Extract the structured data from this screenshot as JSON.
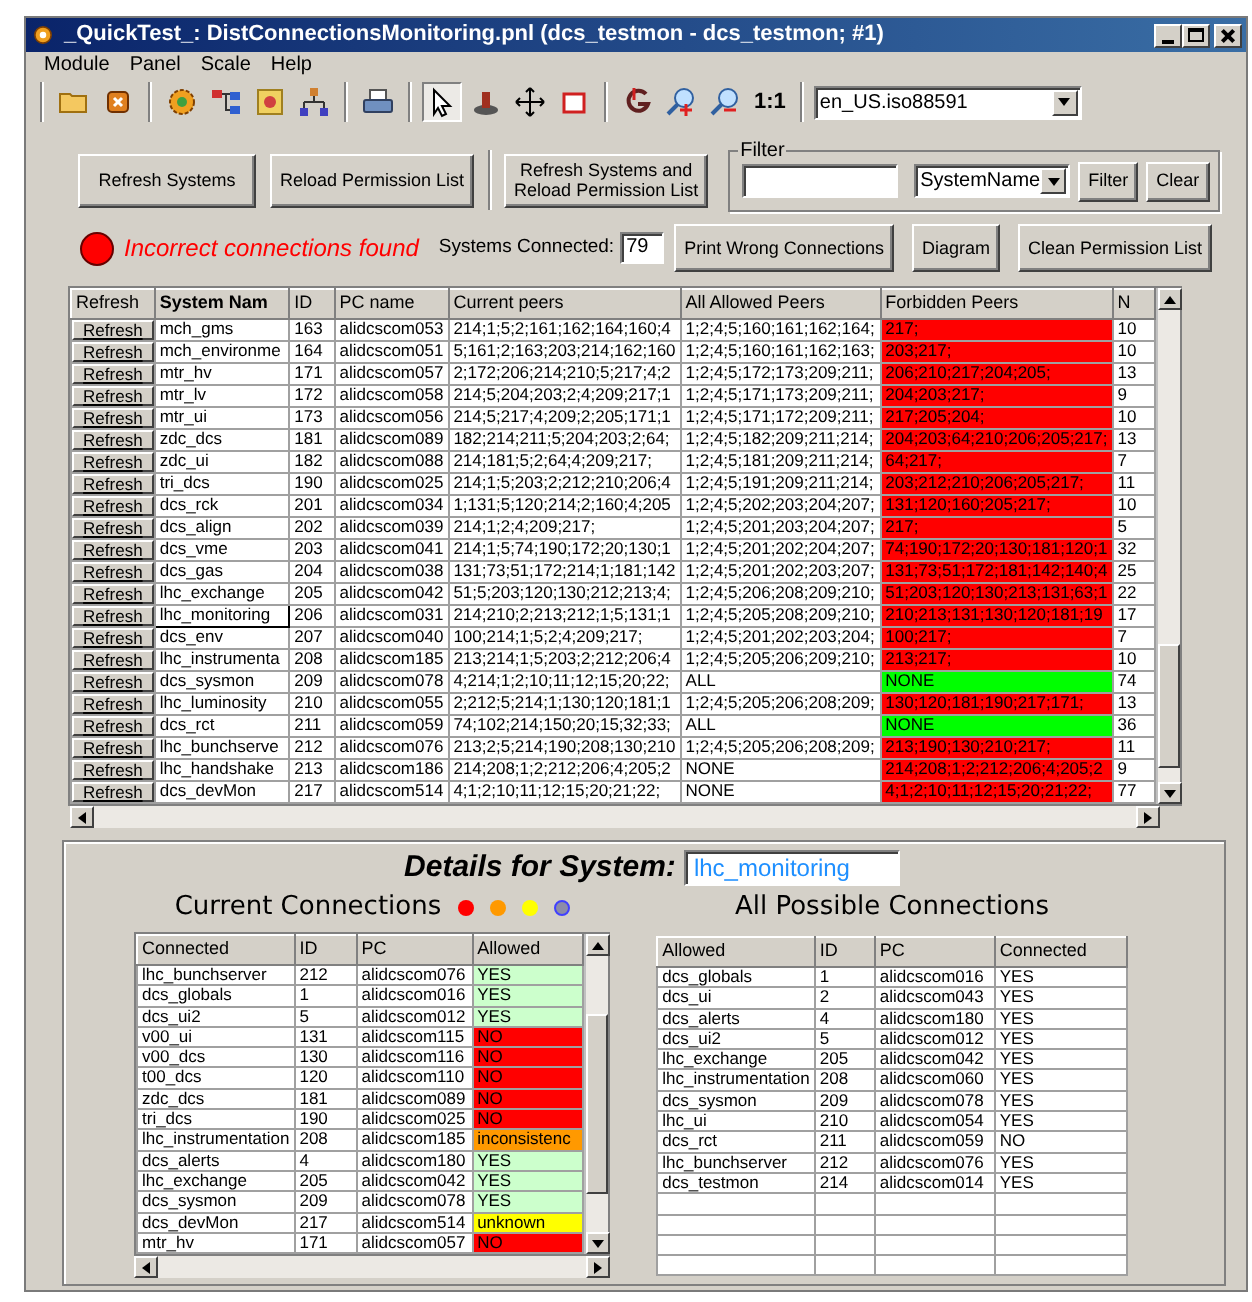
{
  "window": {
    "title": "_QuickTest_: DistConnectionsMonitoring.pnl (dcs_testmon - dcs_testmon; #1)"
  },
  "menu": [
    "Module",
    "Panel",
    "Scale",
    "Help"
  ],
  "toolbar": {
    "groups": [
      [
        {
          "kind": "folder",
          "selected": false
        },
        {
          "kind": "close",
          "selected": false
        }
      ],
      [
        {
          "kind": "gear",
          "selected": false
        },
        {
          "kind": "nodes",
          "selected": false
        },
        {
          "kind": "picture",
          "selected": false
        },
        {
          "kind": "hierarchy",
          "selected": false
        }
      ],
      [
        {
          "kind": "printer",
          "selected": false
        }
      ],
      [
        {
          "kind": "pointer",
          "selected": true
        },
        {
          "kind": "stamp",
          "selected": false
        },
        {
          "kind": "move",
          "selected": false
        },
        {
          "kind": "rectangle",
          "selected": false
        }
      ],
      [
        {
          "kind": "graph",
          "selected": false
        },
        {
          "kind": "zoom-in",
          "selected": false
        },
        {
          "kind": "zoom-out",
          "selected": false
        },
        {
          "kind": "text",
          "label": "1:1",
          "selected": false
        }
      ]
    ],
    "locale": "en_US.iso88591"
  },
  "actions": [
    "Refresh Systems",
    "Reload Permission List"
  ],
  "refresh_all": [
    "Refresh Systems and",
    "Reload Permission List"
  ],
  "filter": {
    "legend": "Filter",
    "field": "SystemName",
    "buttons": [
      "Filter",
      "Clear"
    ]
  },
  "alarm": {
    "active": true,
    "message": "Incorrect connections found"
  },
  "systems_connected": {
    "label": "Systems Connected:",
    "value": "79"
  },
  "tools": [
    "Print Wrong Connections",
    "Diagram",
    "Clean Permission List"
  ],
  "main_table": {
    "columns": [
      "Refresh",
      "System Nam",
      "ID",
      "PC name",
      "Current peers",
      "All Allowed Peers",
      "Forbidden Peers",
      "N"
    ],
    "rows": [
      {
        "button": "Refresh",
        "system": "mch_gms",
        "id": "163",
        "pc": "alidcscom053",
        "current": "214;1;5;2;161;162;164;160;4",
        "allowed": "1;2;4;5;160;161;162;164;",
        "forbidden": "217;",
        "violation": true,
        "n": "10",
        "selected": false
      },
      {
        "button": "Refresh",
        "system": "mch_environme",
        "id": "164",
        "pc": "alidcscom051",
        "current": "5;161;2;163;203;214;162;160",
        "allowed": "1;2;4;5;160;161;162;163;",
        "forbidden": "203;217;",
        "violation": true,
        "n": "10",
        "selected": false
      },
      {
        "button": "Refresh",
        "system": "mtr_hv",
        "id": "171",
        "pc": "alidcscom057",
        "current": "2;172;206;214;210;5;217;4;2",
        "allowed": "1;2;4;5;172;173;209;211;",
        "forbidden": "206;210;217;204;205;",
        "violation": true,
        "n": "13",
        "selected": false
      },
      {
        "button": "Refresh",
        "system": "mtr_lv",
        "id": "172",
        "pc": "alidcscom058",
        "current": "214;5;204;203;2;4;209;217;1",
        "allowed": "1;2;4;5;171;173;209;211;",
        "forbidden": "204;203;217;",
        "violation": true,
        "n": "9",
        "selected": false
      },
      {
        "button": "Refresh",
        "system": "mtr_ui",
        "id": "173",
        "pc": "alidcscom056",
        "current": "214;5;217;4;209;2;205;171;1",
        "allowed": "1;2;4;5;171;172;209;211;",
        "forbidden": "217;205;204;",
        "violation": true,
        "n": "10",
        "selected": false
      },
      {
        "button": "Refresh",
        "system": "zdc_dcs",
        "id": "181",
        "pc": "alidcscom089",
        "current": "182;214;211;5;204;203;2;64;",
        "allowed": "1;2;4;5;182;209;211;214;",
        "forbidden": "204;203;64;210;206;205;217;",
        "violation": true,
        "n": "13",
        "selected": false
      },
      {
        "button": "Refresh",
        "system": "zdc_ui",
        "id": "182",
        "pc": "alidcscom088",
        "current": "214;181;5;2;64;4;209;217;",
        "allowed": "1;2;4;5;181;209;211;214;",
        "forbidden": "64;217;",
        "violation": true,
        "n": "7",
        "selected": false
      },
      {
        "button": "Refresh",
        "system": "tri_dcs",
        "id": "190",
        "pc": "alidcscom025",
        "current": "214;1;5;203;2;212;210;206;4",
        "allowed": "1;2;4;5;191;209;211;214;",
        "forbidden": "203;212;210;206;205;217;",
        "violation": true,
        "n": "11",
        "selected": false
      },
      {
        "button": "Refresh",
        "system": "dcs_rck",
        "id": "201",
        "pc": "alidcscom034",
        "current": "1;131;5;120;214;2;160;4;205",
        "allowed": "1;2;4;5;202;203;204;207;",
        "forbidden": "131;120;160;205;217;",
        "violation": true,
        "n": "10",
        "selected": false
      },
      {
        "button": "Refresh",
        "system": "dcs_align",
        "id": "202",
        "pc": "alidcscom039",
        "current": "214;1;2;4;209;217;",
        "allowed": "1;2;4;5;201;203;204;207;",
        "forbidden": "217;",
        "violation": true,
        "n": "5",
        "selected": false
      },
      {
        "button": "Refresh",
        "system": "dcs_vme",
        "id": "203",
        "pc": "alidcscom041",
        "current": "214;1;5;74;190;172;20;130;1",
        "allowed": "1;2;4;5;201;202;204;207;",
        "forbidden": "74;190;172;20;130;181;120;1",
        "violation": true,
        "n": "32",
        "selected": false
      },
      {
        "button": "Refresh",
        "system": "dcs_gas",
        "id": "204",
        "pc": "alidcscom038",
        "current": "131;73;51;172;214;1;181;142",
        "allowed": "1;2;4;5;201;202;203;207;",
        "forbidden": "131;73;51;172;181;142;140;4",
        "violation": true,
        "n": "25",
        "selected": false
      },
      {
        "button": "Refresh",
        "system": "lhc_exchange",
        "id": "205",
        "pc": "alidcscom042",
        "current": "51;5;203;120;130;212;213;4;",
        "allowed": "1;2;4;5;206;208;209;210;",
        "forbidden": "51;203;120;130;213;131;63;1",
        "violation": true,
        "n": "22",
        "selected": false
      },
      {
        "button": "Refresh",
        "system": "lhc_monitoring",
        "id": "206",
        "pc": "alidcscom031",
        "current": "214;210;2;213;212;1;5;131;1",
        "allowed": "1;2;4;5;205;208;209;210;",
        "forbidden": "210;213;131;130;120;181;19",
        "violation": true,
        "n": "17",
        "selected": true
      },
      {
        "button": "Refresh",
        "system": "dcs_env",
        "id": "207",
        "pc": "alidcscom040",
        "current": "100;214;1;5;2;4;209;217;",
        "allowed": "1;2;4;5;201;202;203;204;",
        "forbidden": "100;217;",
        "violation": true,
        "n": "7",
        "selected": false
      },
      {
        "button": "Refresh",
        "system": "lhc_instrumenta",
        "id": "208",
        "pc": "alidcscom185",
        "current": "213;214;1;5;203;2;212;206;4",
        "allowed": "1;2;4;5;205;206;209;210;",
        "forbidden": "213;217;",
        "violation": true,
        "n": "10",
        "selected": false
      },
      {
        "button": "Refresh",
        "system": "dcs_sysmon",
        "id": "209",
        "pc": "alidcscom078",
        "current": "4;214;1;2;10;11;12;15;20;22;",
        "allowed": "ALL",
        "forbidden": "NONE",
        "violation": false,
        "n": "74",
        "selected": false
      },
      {
        "button": "Refresh",
        "system": "lhc_luminosity",
        "id": "210",
        "pc": "alidcscom055",
        "current": "2;212;5;214;1;130;120;181;1",
        "allowed": "1;2;4;5;205;206;208;209;",
        "forbidden": "130;120;181;190;217;171;",
        "violation": true,
        "n": "13",
        "selected": false
      },
      {
        "button": "Refresh",
        "system": "dcs_rct",
        "id": "211",
        "pc": "alidcscom059",
        "current": "74;102;214;150;20;15;32;33;",
        "allowed": "ALL",
        "forbidden": "NONE",
        "violation": false,
        "n": "36",
        "selected": false
      },
      {
        "button": "Refresh",
        "system": "lhc_bunchserve",
        "id": "212",
        "pc": "alidcscom076",
        "current": "213;2;5;214;190;208;130;210",
        "allowed": "1;2;4;5;205;206;208;209;",
        "forbidden": "213;190;130;210;217;",
        "violation": true,
        "n": "11",
        "selected": false
      },
      {
        "button": "Refresh",
        "system": "lhc_handshake",
        "id": "213",
        "pc": "alidcscom186",
        "current": "214;208;1;2;212;206;4;205;2",
        "allowed": "NONE",
        "forbidden": "214;208;1;2;212;206;4;205;2",
        "violation": true,
        "n": "9",
        "selected": false
      },
      {
        "button": "Refresh",
        "system": "dcs_devMon",
        "id": "217",
        "pc": "alidcscom514",
        "current": "4;1;2;10;11;12;15;20;21;22;",
        "allowed": "NONE",
        "forbidden": "4;1;2;10;11;12;15;20;21;22;",
        "violation": true,
        "n": "77",
        "selected": false
      }
    ]
  },
  "details": {
    "title": "Details for System:",
    "system": "lhc_monitoring"
  },
  "current_connections": {
    "title": "Current Connections",
    "legend": [
      {
        "color": "#ff0000"
      },
      {
        "color": "#ff9900"
      },
      {
        "color": "#ffff00"
      },
      {
        "color": "#8c8ca8"
      }
    ],
    "columns": [
      "Connected",
      "ID",
      "PC",
      "Allowed"
    ],
    "rows": [
      {
        "name": "lhc_bunchserver",
        "id": "212",
        "pc": "alidcscom076",
        "allowed": "YES",
        "color": "#ccffcc"
      },
      {
        "name": "dcs_globals",
        "id": "1",
        "pc": "alidcscom016",
        "allowed": "YES",
        "color": "#ccffcc"
      },
      {
        "name": "dcs_ui2",
        "id": "5",
        "pc": "alidcscom012",
        "allowed": "YES",
        "color": "#ccffcc"
      },
      {
        "name": "v00_ui",
        "id": "131",
        "pc": "alidcscom115",
        "allowed": "NO",
        "color": "#ff0000"
      },
      {
        "name": "v00_dcs",
        "id": "130",
        "pc": "alidcscom116",
        "allowed": "NO",
        "color": "#ff0000"
      },
      {
        "name": "t00_dcs",
        "id": "120",
        "pc": "alidcscom110",
        "allowed": "NO",
        "color": "#ff0000"
      },
      {
        "name": "zdc_dcs",
        "id": "181",
        "pc": "alidcscom089",
        "allowed": "NO",
        "color": "#ff0000"
      },
      {
        "name": "tri_dcs",
        "id": "190",
        "pc": "alidcscom025",
        "allowed": "NO",
        "color": "#ff0000"
      },
      {
        "name": "lhc_instrumentation",
        "id": "208",
        "pc": "alidcscom185",
        "allowed": "inconsistenc",
        "color": "#ff9900"
      },
      {
        "name": "dcs_alerts",
        "id": "4",
        "pc": "alidcscom180",
        "allowed": "YES",
        "color": "#ccffcc"
      },
      {
        "name": "lhc_exchange",
        "id": "205",
        "pc": "alidcscom042",
        "allowed": "YES",
        "color": "#ccffcc"
      },
      {
        "name": "dcs_sysmon",
        "id": "209",
        "pc": "alidcscom078",
        "allowed": "YES",
        "color": "#ccffcc"
      },
      {
        "name": "dcs_devMon",
        "id": "217",
        "pc": "alidcscom514",
        "allowed": "unknown",
        "color": "#ffff00"
      },
      {
        "name": "mtr_hv",
        "id": "171",
        "pc": "alidcscom057",
        "allowed": "NO",
        "color": "#ff0000"
      }
    ]
  },
  "possible_connections": {
    "title": "All Possible Connections",
    "columns": [
      "Allowed",
      "ID",
      "PC",
      "Connected"
    ],
    "rows": [
      {
        "name": "dcs_globals",
        "id": "1",
        "pc": "alidcscom016",
        "connected": "YES"
      },
      {
        "name": "dcs_ui",
        "id": "2",
        "pc": "alidcscom043",
        "connected": "YES"
      },
      {
        "name": "dcs_alerts",
        "id": "4",
        "pc": "alidcscom180",
        "connected": "YES"
      },
      {
        "name": "dcs_ui2",
        "id": "5",
        "pc": "alidcscom012",
        "connected": "YES"
      },
      {
        "name": "lhc_exchange",
        "id": "205",
        "pc": "alidcscom042",
        "connected": "YES"
      },
      {
        "name": "lhc_instrumentation",
        "id": "208",
        "pc": "alidcscom060",
        "connected": "YES"
      },
      {
        "name": "dcs_sysmon",
        "id": "209",
        "pc": "alidcscom078",
        "connected": "YES"
      },
      {
        "name": "lhc_ui",
        "id": "210",
        "pc": "alidcscom054",
        "connected": "YES"
      },
      {
        "name": "dcs_rct",
        "id": "211",
        "pc": "alidcscom059",
        "connected": "NO"
      },
      {
        "name": "lhc_bunchserver",
        "id": "212",
        "pc": "alidcscom076",
        "connected": "YES"
      },
      {
        "name": "dcs_testmon",
        "id": "214",
        "pc": "alidcscom014",
        "connected": "YES"
      }
    ]
  }
}
